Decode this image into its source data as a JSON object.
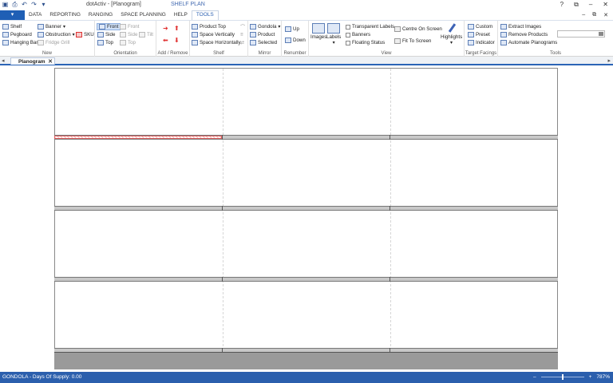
{
  "window": {
    "title": "dotActiv - [Planogram]",
    "context_tab": "SHELF PLAN"
  },
  "ribbon_tabs": [
    "DATA",
    "REPORTING",
    "RANGING",
    "SPACE PLANNING",
    "HELP",
    "TOOLS"
  ],
  "active_tab": "TOOLS",
  "groups": {
    "new": {
      "label": "New",
      "items": [
        "Shelf",
        "Pegboard",
        "Hanging Bar",
        "Banner",
        "Obstruction",
        "Fridge Grill",
        "SKU"
      ]
    },
    "orientation": {
      "label": "Orientation",
      "items": [
        "Front",
        "Side",
        "Top",
        "Front",
        "Side",
        "Top",
        "Tilt"
      ]
    },
    "add_remove": {
      "label": "Add / Remove"
    },
    "shelf": {
      "label": "Shelf",
      "items": [
        "Product Top",
        "Space Vertically",
        "Space Horizontally"
      ]
    },
    "mirror": {
      "label": "Mirror",
      "items": [
        "Gondola",
        "Product",
        "Selected"
      ]
    },
    "renumber": {
      "label": "Renumber",
      "items": [
        "Up",
        "Down"
      ]
    },
    "view": {
      "label": "View",
      "images": "Images",
      "labels": "Labels",
      "checkboxes": [
        "Transparent Labels",
        "Banners",
        "Floating Status"
      ],
      "centre": "Centre On Screen",
      "fit": "Fit To Screen",
      "highlights": "Highlights"
    },
    "target_facings": {
      "label": "Target Facings",
      "items": [
        "Custom",
        "Preset",
        "Indicator"
      ]
    },
    "tools": {
      "label": "Tools",
      "items": [
        "Extract Images",
        "Remove Products",
        "Automate Planograms"
      ]
    }
  },
  "document_tab": "Planogram",
  "status": {
    "left": "GONDOLA - Days Of Supply: 0.00",
    "zoom": "787%"
  }
}
